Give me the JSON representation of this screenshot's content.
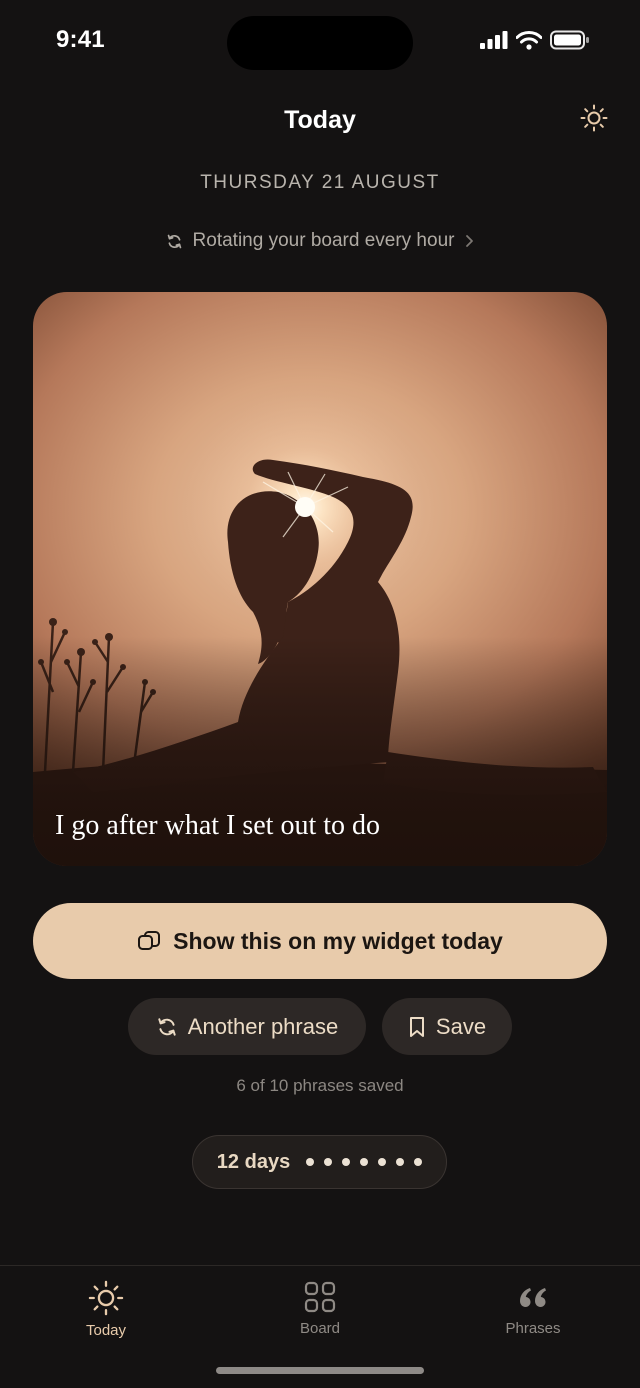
{
  "status_bar": {
    "time": "9:41"
  },
  "header": {
    "title": "Today",
    "date": "THURSDAY 21 AUGUST",
    "rotation_text": "Rotating your board every hour"
  },
  "card": {
    "quote": "I go after what I set out to do"
  },
  "actions": {
    "widget_label": "Show this on my widget today",
    "another_label": "Another phrase",
    "save_label": "Save",
    "saved_count": "6 of 10 phrases saved"
  },
  "streak": {
    "label": "12 days",
    "dots": 7
  },
  "tabs": [
    {
      "label": "Today",
      "icon": "sun-icon",
      "active": true
    },
    {
      "label": "Board",
      "icon": "grid-icon",
      "active": false
    },
    {
      "label": "Phrases",
      "icon": "quote-icon",
      "active": false
    }
  ],
  "colors": {
    "background": "#141212",
    "accent": "#e8cbab",
    "pill": "#2d2826"
  }
}
